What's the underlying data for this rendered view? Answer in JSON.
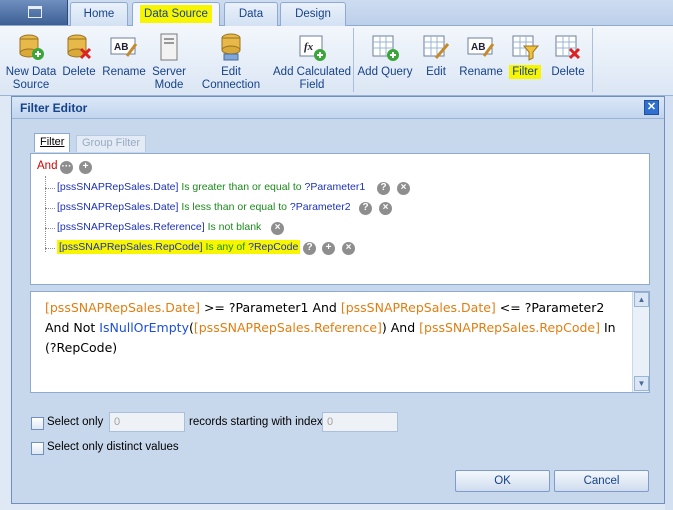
{
  "ribbon": {
    "tabs": [
      {
        "label": "Home"
      },
      {
        "label": "Data Source"
      },
      {
        "label": "Data"
      },
      {
        "label": "Design"
      }
    ],
    "data_source_buttons": [
      {
        "label": "New Data Source",
        "line1": "New Data",
        "line2": "Source",
        "icon": "database-add-icon"
      },
      {
        "label": "Delete",
        "icon": "database-delete-icon"
      },
      {
        "label": "Rename",
        "icon": "rename-icon"
      },
      {
        "label": "Server Mode",
        "line1": "Server",
        "line2": "Mode",
        "icon": "server-mode-icon"
      },
      {
        "label": "Edit Connection",
        "icon": "edit-connection-icon"
      },
      {
        "label": "Add Calculated Field",
        "line1": "Add Calculated",
        "line2": "Field",
        "icon": "calculated-field-icon"
      }
    ],
    "query_buttons": [
      {
        "label": "Add Query",
        "icon": "add-query-icon"
      },
      {
        "label": "Edit",
        "icon": "edit-query-icon"
      },
      {
        "label": "Rename",
        "icon": "rename-icon"
      },
      {
        "label": "Filter",
        "icon": "filter-icon"
      },
      {
        "label": "Delete",
        "icon": "delete-query-icon"
      }
    ],
    "highlight_color": "#f7f500"
  },
  "dialog": {
    "title": "Filter Editor",
    "tabs": {
      "filter": "Filter",
      "group_filter": "Group Filter"
    },
    "root_operator": "And",
    "conditions": [
      {
        "field": "[pssSNAPRepSales.Date]",
        "operator": "Is greater than or equal to",
        "value": "?Parameter1"
      },
      {
        "field": "[pssSNAPRepSales.Date]",
        "operator": "Is less than or equal to",
        "value": "?Parameter2"
      },
      {
        "field": "[pssSNAPRepSales.Reference]",
        "operator": "Is not blank",
        "value": ""
      },
      {
        "field": "[pssSNAPRepSales.RepCode]",
        "operator": "Is any of",
        "value": "?RepCode"
      }
    ],
    "expression": {
      "f1": "[pssSNAPRepSales.Date]",
      "t1": " >= ?Parameter1 And ",
      "f2": "[pssSNAPRepSales.Date]",
      "t2": " <= ?Parameter2 And Not ",
      "func": "IsNullOrEmpty",
      "t3": "(",
      "f3": "[pssSNAPRepSales.Reference]",
      "t4": ") And ",
      "f4": "[pssSNAPRepSales.RepCode]",
      "t5": " In (?RepCode)"
    },
    "options": {
      "select_only_label": "Select only",
      "select_only_value": "0",
      "records_label": "records starting with index",
      "start_index_value": "0",
      "distinct_label": "Select only distinct values"
    },
    "ok_label": "OK",
    "cancel_label": "Cancel"
  }
}
